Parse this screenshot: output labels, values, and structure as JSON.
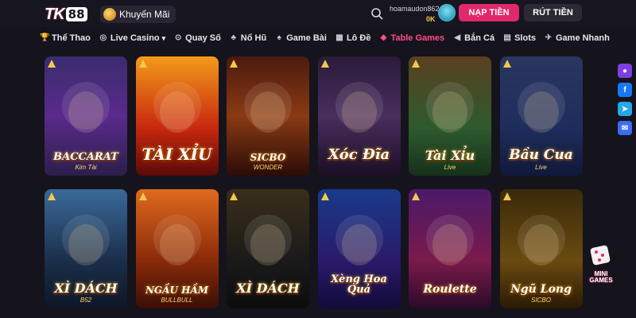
{
  "brand": {
    "logo_text": "TK",
    "logo_num": "88"
  },
  "header": {
    "promo_label": "Khuyến Mãi",
    "username": "hoamaudon862",
    "balance": "0K",
    "deposit_label": "NẠP TIỀN",
    "withdraw_label": "RÚT TIỀN"
  },
  "nav": {
    "items": [
      {
        "label": "Thể Thao",
        "icon": "trophy-icon"
      },
      {
        "label": "Live Casino",
        "icon": "chip-icon"
      },
      {
        "label": "Quay Số",
        "icon": "lottery-icon"
      },
      {
        "label": "Nổ Hũ",
        "icon": "jar-icon"
      },
      {
        "label": "Game Bài",
        "icon": "cards-icon"
      },
      {
        "label": "Lô Đề",
        "icon": "number-icon"
      },
      {
        "label": "Table Games",
        "icon": "dice-icon"
      },
      {
        "label": "Bắn Cá",
        "icon": "fish-icon"
      },
      {
        "label": "Slots",
        "icon": "slot-icon"
      },
      {
        "label": "Game Nhanh",
        "icon": "rocket-icon"
      }
    ],
    "active_index": 6
  },
  "games": [
    {
      "title": "BACCARAT",
      "subtitle": "Kim Tài"
    },
    {
      "title": "TÀI XỈU",
      "subtitle": ""
    },
    {
      "title": "SICBO",
      "subtitle": "WONDER"
    },
    {
      "title": "Xóc Đĩa",
      "subtitle": ""
    },
    {
      "title": "Tài Xỉu",
      "subtitle": "Live"
    },
    {
      "title": "Bầu Cua",
      "subtitle": "Live"
    },
    {
      "title": "XÌ DÁCH",
      "subtitle": "B52"
    },
    {
      "title": "NGẦU HẦM",
      "subtitle": "BULLBULL"
    },
    {
      "title": "XÌ DÁCH",
      "subtitle": ""
    },
    {
      "title": "Xèng Hoa Quả",
      "subtitle": ""
    },
    {
      "title": "Roulette",
      "subtitle": ""
    },
    {
      "title": "Ngũ Long",
      "subtitle": "SICBO"
    }
  ],
  "side": {
    "items": [
      "chat-icon",
      "facebook-icon",
      "telegram-icon",
      "messenger-icon"
    ]
  },
  "mini_games_label": "MINI GAMES",
  "colors": {
    "accent": "#e0286a",
    "background": "#15131c",
    "gold": "#f2c94c"
  }
}
